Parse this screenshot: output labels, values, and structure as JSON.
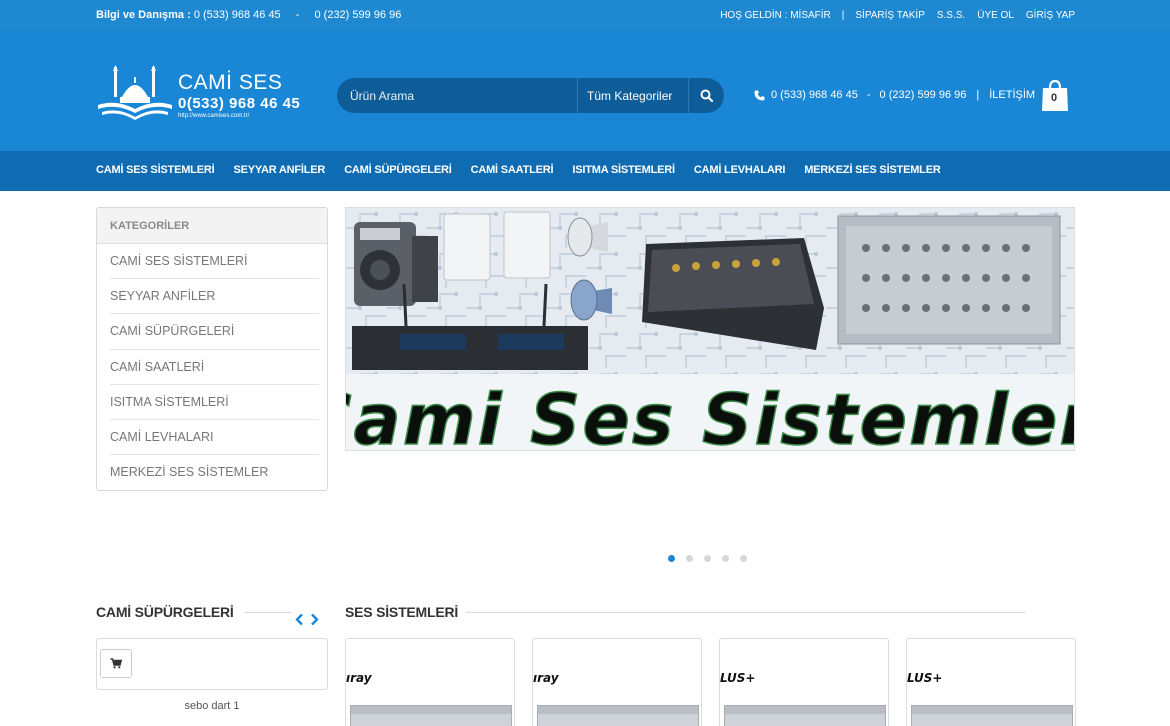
{
  "topbar": {
    "info_label": "Bilgi ve Danışma :",
    "phone1": "0 (533) 968 46 45",
    "separator": "-",
    "phone2": "0 (232) 599 96 96",
    "welcome": "HOŞ GELDİN : MİSAFİR",
    "links": [
      "SİPARİŞ TAKİP",
      "S.S.S.",
      "ÜYE OL",
      "GİRİŞ YAP"
    ]
  },
  "logo": {
    "brand": "CAMİ SES",
    "phone": "0(533) 968 46 45",
    "url": "http://www.camises.com.tr/"
  },
  "search": {
    "placeholder": "Ürün Arama",
    "category": "Tüm Kategoriler",
    "button_icon": "search-icon"
  },
  "contact": {
    "phone_icon": "phone-icon",
    "phone1": "0 (533) 968 46 45",
    "separator": "-",
    "phone2": "0 (232) 599 96 96",
    "link": "İLETİŞİM"
  },
  "cart": {
    "count": "0",
    "icon": "shopping-bag-icon"
  },
  "nav": {
    "items": [
      "CAMİ SES SİSTEMLERİ",
      "SEYYAR ANFİLER",
      "CAMİ SÜPÜRGELERİ",
      "CAMİ SAATLERİ",
      "ISITMA SİSTEMLERİ",
      "CAMİ LEVHALARI",
      "MERKEZİ SES SİSTEMLER"
    ]
  },
  "sidebar": {
    "title": "KATEGORİLER",
    "items": [
      "CAMİ SES SİSTEMLERİ",
      "SEYYAR ANFİLER",
      "CAMİ SÜPÜRGELERİ",
      "CAMİ SAATLERİ",
      "ISITMA SİSTEMLERİ",
      "CAMİ LEVHALARI",
      "MERKEZİ SES SİSTEMLER"
    ]
  },
  "banner": {
    "text": "Cami Ses Sistemleri",
    "slide_count": 5,
    "active_slide": 1
  },
  "section_left": {
    "title": "CAMİ SÜPÜRGELERİ",
    "product_name": "sebo dart 1"
  },
  "section_right": {
    "title": "SES SİSTEMLERİ",
    "products": [
      {
        "brand": "ıray"
      },
      {
        "brand": "ıray"
      },
      {
        "brand": "LUS+"
      },
      {
        "brand": "LUS+"
      }
    ]
  },
  "colors": {
    "topbar": "#1e88d1",
    "header": "#1a86d6",
    "nav": "#0f6cb3",
    "search": "#0e5d99",
    "accent": "#1a86d6"
  }
}
